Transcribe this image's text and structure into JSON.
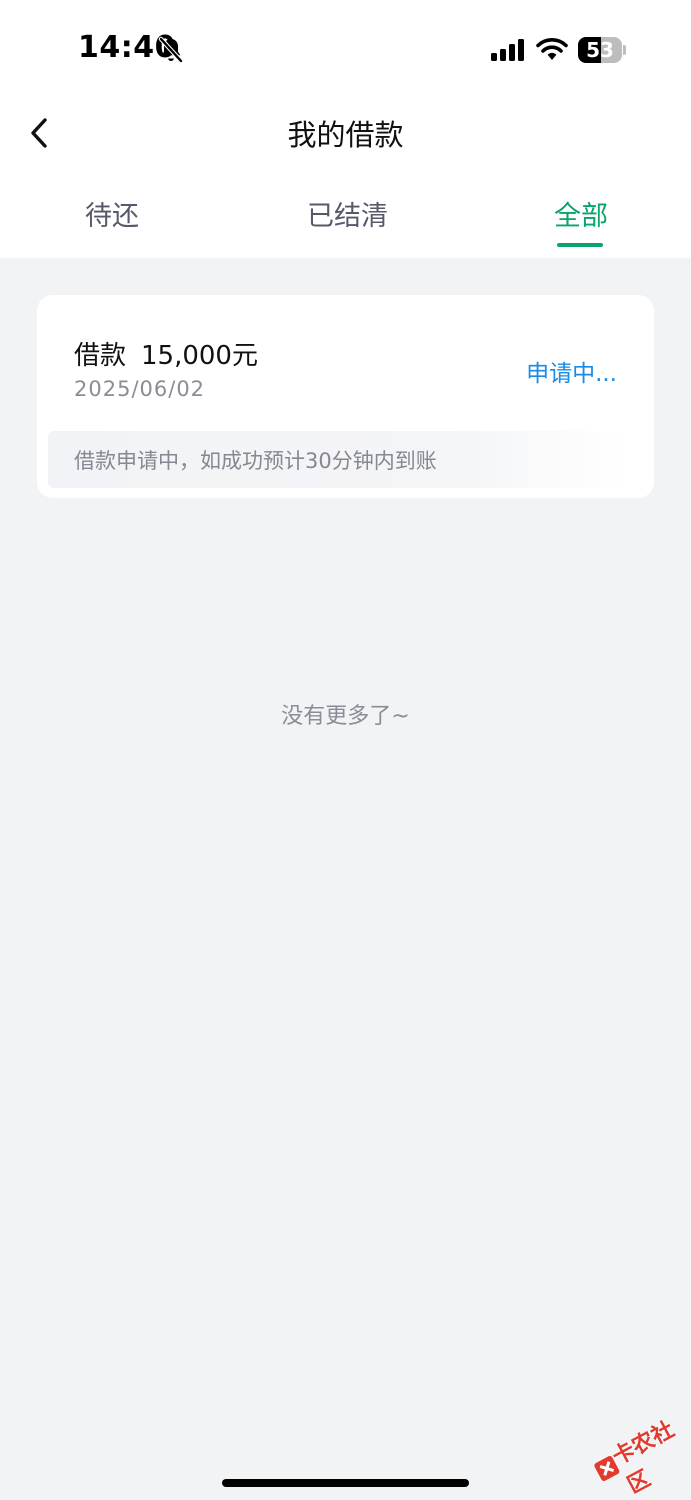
{
  "status_bar": {
    "time": "14:40",
    "battery_level": "53",
    "battery_fraction": 0.53
  },
  "nav": {
    "title": "我的借款"
  },
  "tabs": [
    {
      "label": "待还",
      "active": false
    },
    {
      "label": "已结清",
      "active": false
    },
    {
      "label": "全部",
      "active": true
    }
  ],
  "loan_card": {
    "label": "借款",
    "amount": "15,000元",
    "date": "2025/06/02",
    "status": "申请中...",
    "notice": "借款申请中，如成功预计30分钟内到账"
  },
  "footer": {
    "no_more_text": "没有更多了~"
  },
  "watermark": {
    "text": "卡农社区"
  },
  "colors": {
    "accent_green": "#0aa56b",
    "status_blue": "#1a8be6",
    "page_background": "#f2f3f5"
  },
  "icons": [
    "bell-slash-icon",
    "signal-icon",
    "wifi-icon",
    "battery-icon",
    "back-arrow-icon"
  ]
}
